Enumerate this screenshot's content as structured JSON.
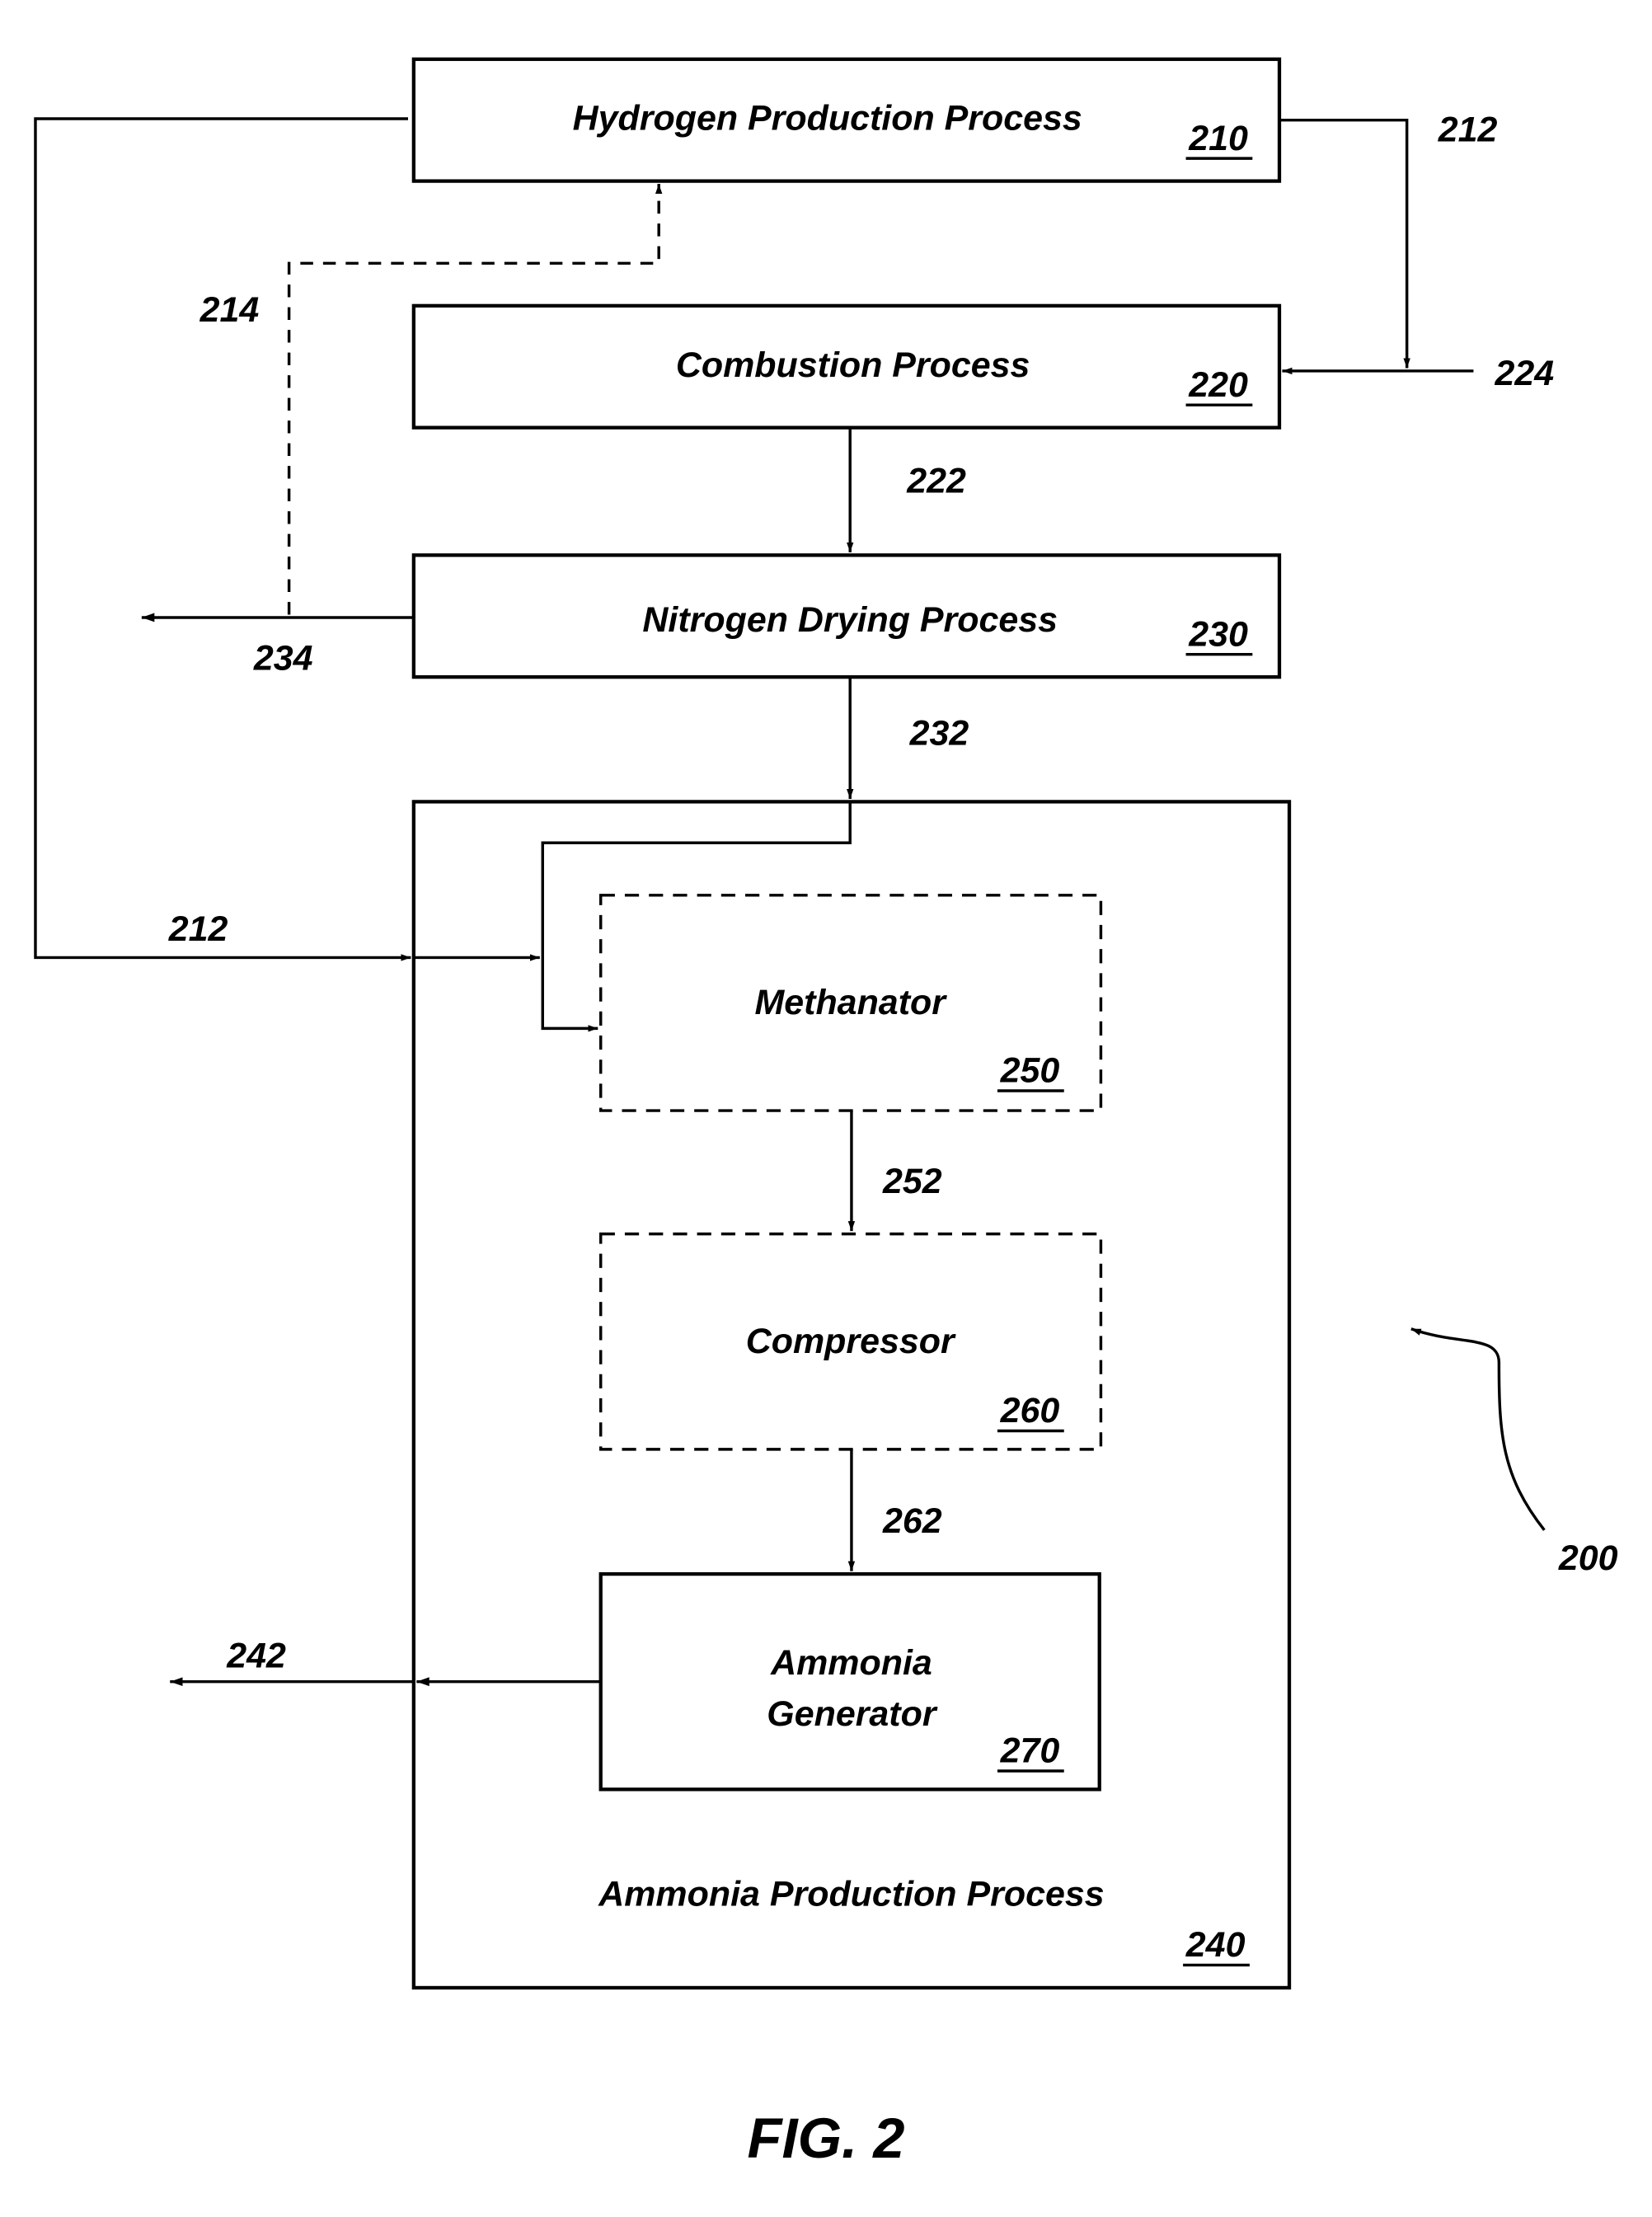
{
  "figure": {
    "caption": "FIG. 2",
    "system_ref": "200"
  },
  "blocks": {
    "hydrogen": {
      "label": "Hydrogen Production Process",
      "ref": "210",
      "style": "solid"
    },
    "combustion": {
      "label": "Combustion Process",
      "ref": "220",
      "style": "solid"
    },
    "nitrogen": {
      "label": "Nitrogen Drying Process",
      "ref": "230",
      "style": "solid"
    },
    "ammonia_process": {
      "label": "Ammonia Production Process",
      "ref": "240",
      "style": "solid"
    },
    "methanator": {
      "label": "Methanator",
      "ref": "250",
      "style": "dashed"
    },
    "compressor": {
      "label": "Compressor",
      "ref": "260",
      "style": "dashed"
    },
    "generator": {
      "label_line1": "Ammonia",
      "label_line2": "Generator",
      "ref": "270",
      "style": "solid"
    }
  },
  "streams": {
    "s212_top": "212",
    "s212_left": "212",
    "s214": "214",
    "s222": "222",
    "s224": "224",
    "s232": "232",
    "s234": "234",
    "s242": "242",
    "s252": "252",
    "s262": "262"
  },
  "connections": [
    {
      "ref": "212",
      "from": "Hydrogen Production Process",
      "to": "Combustion Process",
      "style": "solid"
    },
    {
      "ref": "212",
      "from": "Hydrogen Production Process",
      "to": "Methanator",
      "style": "solid"
    },
    {
      "ref": "224",
      "from": "external",
      "to": "Combustion Process",
      "style": "solid"
    },
    {
      "ref": "222",
      "from": "Combustion Process",
      "to": "Nitrogen Drying Process",
      "style": "solid"
    },
    {
      "ref": "234",
      "from": "Nitrogen Drying Process",
      "to": "external",
      "style": "solid"
    },
    {
      "ref": "214",
      "from": "234",
      "to": "Hydrogen Production Process",
      "style": "dashed"
    },
    {
      "ref": "232",
      "from": "Nitrogen Drying Process",
      "to": "Methanator",
      "style": "solid"
    },
    {
      "ref": "252",
      "from": "Methanator",
      "to": "Compressor",
      "style": "solid"
    },
    {
      "ref": "262",
      "from": "Compressor",
      "to": "Ammonia Generator",
      "style": "solid"
    },
    {
      "ref": "242",
      "from": "Ammonia Generator",
      "to": "external",
      "style": "solid"
    }
  ]
}
